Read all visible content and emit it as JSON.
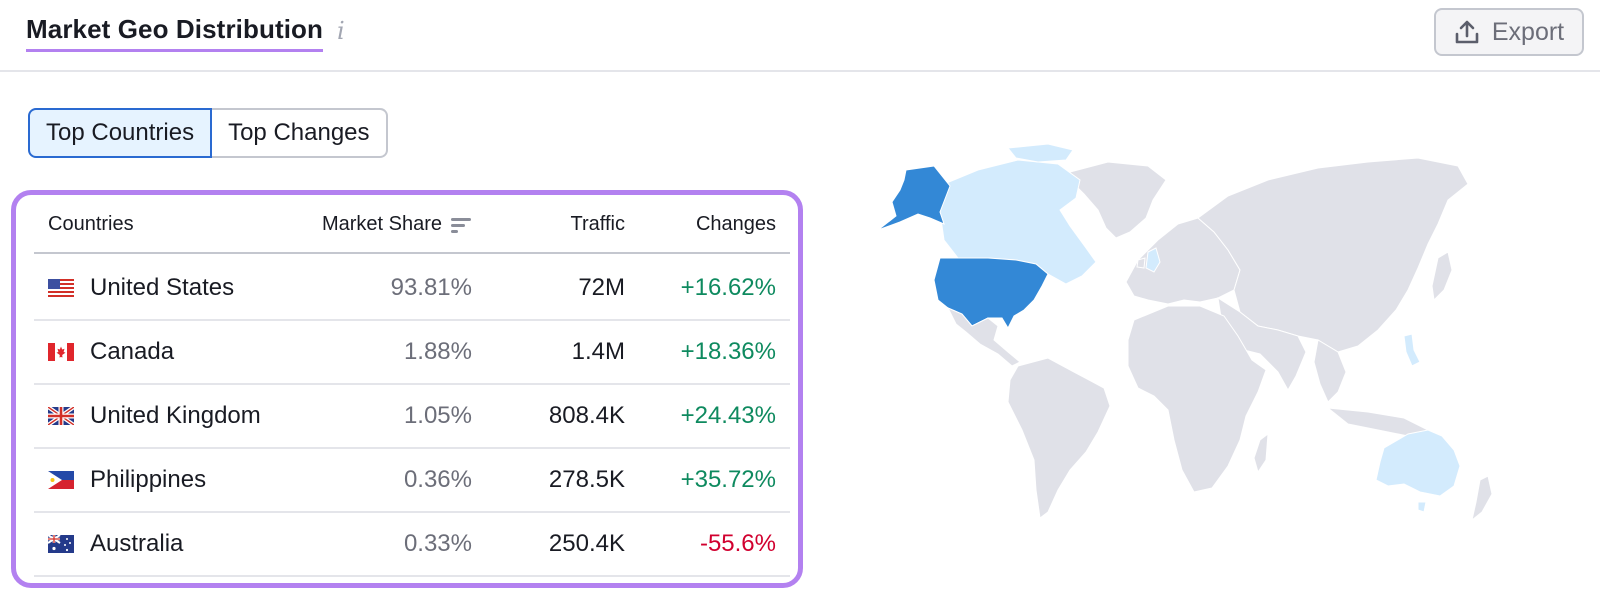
{
  "header": {
    "title": "Market Geo Distribution",
    "info_icon": "info-icon",
    "export_label": "Export",
    "export_icon": "upload-icon"
  },
  "tabs": [
    {
      "label": "Top Countries",
      "active": true
    },
    {
      "label": "Top Changes",
      "active": false
    }
  ],
  "table": {
    "columns": [
      "Countries",
      "Market Share",
      "Traffic",
      "Changes"
    ],
    "sort_icon": "sort-descending-icon",
    "rows": [
      {
        "flag": "us",
        "country": "United States",
        "market_share": "93.81%",
        "traffic": "72M",
        "change": "+16.62%",
        "trend": "positive"
      },
      {
        "flag": "ca",
        "country": "Canada",
        "market_share": "1.88%",
        "traffic": "1.4M",
        "change": "+18.36%",
        "trend": "positive"
      },
      {
        "flag": "gb",
        "country": "United Kingdom",
        "market_share": "1.05%",
        "traffic": "808.4K",
        "change": "+24.43%",
        "trend": "positive"
      },
      {
        "flag": "ph",
        "country": "Philippines",
        "market_share": "0.36%",
        "traffic": "278.5K",
        "change": "+35.72%",
        "trend": "positive"
      },
      {
        "flag": "au",
        "country": "Australia",
        "market_share": "0.33%",
        "traffic": "250.4K",
        "change": "-55.6%",
        "trend": "negative"
      }
    ]
  },
  "map": {
    "highlight_strong": [
      "United States"
    ],
    "highlight_light": [
      "Canada",
      "United Kingdom",
      "Philippines",
      "Australia"
    ],
    "colors": {
      "strong": "#3388d6",
      "light": "#d3ebfd",
      "base": "#e0e1e8"
    }
  },
  "colors": {
    "accent_purple": "#b381f0",
    "active_tab_border": "#2a6ad1",
    "active_tab_bg": "#e6f3ff",
    "positive": "#0e8a5f",
    "negative": "#d1002f"
  }
}
